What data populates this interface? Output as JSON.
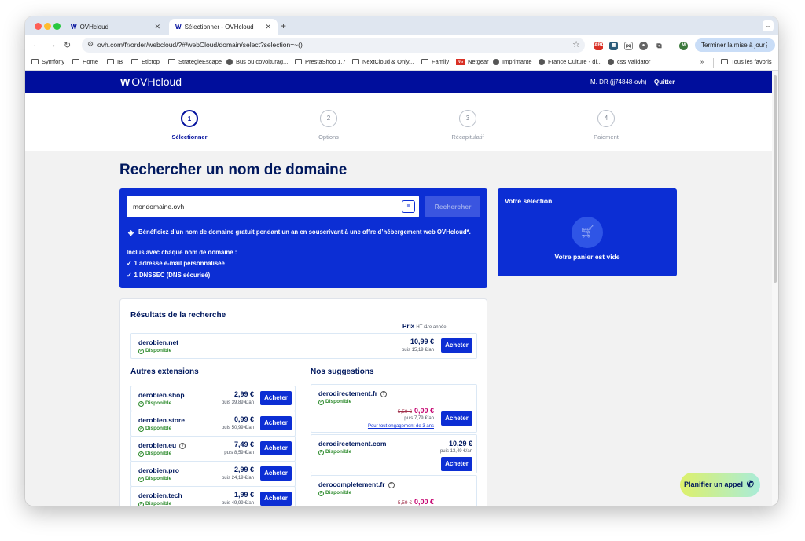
{
  "browser": {
    "tabs": [
      {
        "title": "OVHcloud",
        "active": false
      },
      {
        "title": "Sélectionner - OVHcloud",
        "active": true
      }
    ],
    "favicon_text": "W",
    "url": "ovh.com/fr/order/webcloud/?#/webCloud/domain/select?selection=~()",
    "update_button": "Terminer la mise à jour",
    "profile_initial": "M",
    "bookmarks": [
      {
        "label": "Symfony",
        "icon": "folder"
      },
      {
        "label": "Home",
        "icon": "folder"
      },
      {
        "label": "IB",
        "icon": "folder"
      },
      {
        "label": "Etictop",
        "icon": "folder"
      },
      {
        "label": "StrategieEscape",
        "icon": "folder"
      },
      {
        "label": "Bus ou covoiturag...",
        "icon": "globe"
      },
      {
        "label": "PrestaShop 1.7",
        "icon": "folder"
      },
      {
        "label": "NextCloud & Only...",
        "icon": "folder"
      },
      {
        "label": "Family",
        "icon": "folder"
      },
      {
        "label": "Netgear",
        "icon": "red"
      },
      {
        "label": "Imprimante",
        "icon": "globe"
      },
      {
        "label": "France Culture - di...",
        "icon": "globe"
      },
      {
        "label": "css Validator",
        "icon": "globe"
      }
    ],
    "bookmarks_more": "»",
    "all_bookmarks": "Tous les favoris"
  },
  "header": {
    "brand": "OVHcloud",
    "user": "M. DR (jj74848-ovh)",
    "quit": "Quitter"
  },
  "steps": [
    {
      "num": "1",
      "label": "Sélectionner",
      "active": true
    },
    {
      "num": "2",
      "label": "Options",
      "active": false
    },
    {
      "num": "3",
      "label": "Récapitulatif",
      "active": false
    },
    {
      "num": "4",
      "label": "Paiement",
      "active": false
    }
  ],
  "page": {
    "title": "Rechercher un nom de domaine",
    "search_value": "mondomaine.ovh",
    "search_button": "Rechercher",
    "promo": "Bénéficiez d’un nom de domaine gratuit pendant un an en souscrivant à une offre d’hébergement web OVHcloud*.",
    "included_title": "Inclus avec chaque nom de domaine :",
    "included": [
      "1 adresse e-mail personnalisée",
      "1 DNSSEC (DNS sécurisé)"
    ]
  },
  "selection": {
    "title": "Votre sélection",
    "empty": "Votre panier est vide"
  },
  "results": {
    "title": "Résultats de la recherche",
    "price_label": "Prix",
    "price_note": "HT /1re année",
    "available": "Disponible",
    "buy": "Acheter",
    "main": {
      "name": "derobien.net",
      "price": "10,99 €",
      "renewal": "puis 15,19 €/an"
    },
    "other_title": "Autres extensions",
    "others": [
      {
        "name": "derobien.shop",
        "price": "2,99 €",
        "renewal": "puis 39,89 €/an",
        "help": false
      },
      {
        "name": "derobien.store",
        "price": "0,99 €",
        "renewal": "puis 50,99 €/an",
        "help": false
      },
      {
        "name": "derobien.eu",
        "price": "7,49 €",
        "renewal": "puis 8,59 €/an",
        "help": true
      },
      {
        "name": "derobien.pro",
        "price": "2,99 €",
        "renewal": "puis 24,19 €/an",
        "help": false
      },
      {
        "name": "derobien.tech",
        "price": "1,99 €",
        "renewal": "puis 49,99 €/an",
        "help": false
      }
    ],
    "sugg_title": "Nos suggestions",
    "suggestions": [
      {
        "name": "derodirectement.fr",
        "old_price": "5,59 €",
        "price": "0,00 €",
        "renewal": "puis 7,79 €/an",
        "engagement": "Pour tout engagement de 3 ans"
      },
      {
        "name": "derodirectement.com",
        "price": "10,29 €",
        "renewal": "puis 13,49 €/an"
      },
      {
        "name": "derocompletement.fr",
        "old_price": "5,59 €",
        "price": "0,00 €"
      }
    ]
  },
  "call_button": "Planifier un appel"
}
